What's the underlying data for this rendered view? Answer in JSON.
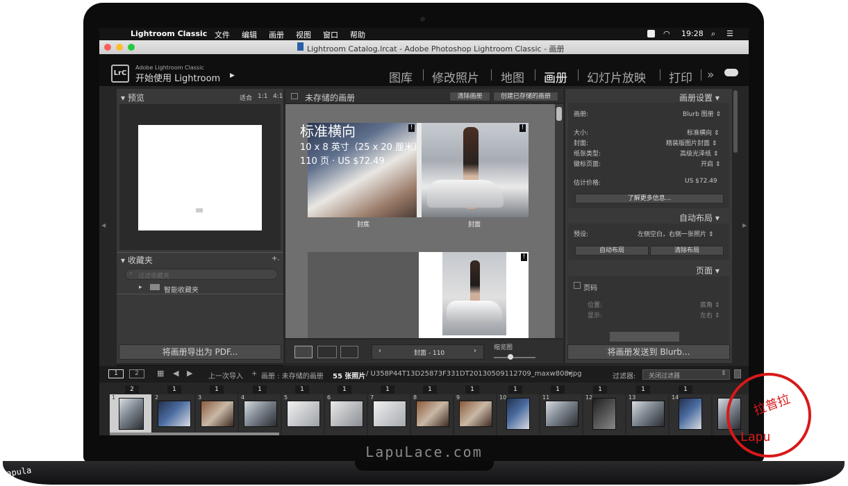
{
  "menubar": {
    "app": "Lightroom Classic",
    "items": [
      "文件",
      "编辑",
      "画册",
      "视图",
      "窗口",
      "帮助"
    ],
    "time": "19:28"
  },
  "window": {
    "title": "Lightroom Catalog.lrcat - Adobe Photoshop Lightroom Classic - 画册"
  },
  "identity": {
    "brand": "Adobe Lightroom Classic",
    "title": "开始使用 Lightroom",
    "logo": "LrC"
  },
  "modules": {
    "library": "图库",
    "develop": "修改照片",
    "map": "地图",
    "book": "画册",
    "slideshow": "幻灯片放映",
    "print": "打印",
    "more": "»"
  },
  "left": {
    "preview": {
      "title": "预览",
      "fit": "适合",
      "z1": "1:1",
      "z4": "4:1"
    },
    "collections": {
      "title": "收藏夹",
      "add": "+.",
      "filter_placeholder": "过滤收藏夹",
      "smart": "智能收藏夹"
    },
    "export_pdf": "将画册导出为 PDF..."
  },
  "center": {
    "header": "未存储的画册",
    "clear": "清除画册",
    "create": "创建已存储的画册",
    "overlay_line1": "标准横向",
    "overlay_line2": "10 x 8 英寸（25 x 20 厘米）",
    "overlay_line3": "110 页 · US $72.49",
    "back_cover": "封底",
    "front_cover": "封面",
    "page_indicator": "封面 - 110",
    "thumb_label": "缩览图"
  },
  "right": {
    "book_settings": {
      "title": "画册设置",
      "book_label": "画册:",
      "book_value": "Blurb 图册",
      "size_label": "大小:",
      "size_value": "标准横向",
      "cover_label": "封面:",
      "cover_value": "精装版图片封面",
      "paper_label": "纸张类型:",
      "paper_value": "高级光泽纸",
      "logo_label": "徽标页面:",
      "logo_value": "开启",
      "price_label": "估计价格:",
      "price_value": "US $72.49",
      "learn_more": "了解更多信息..."
    },
    "auto_layout": {
      "title": "自动布局",
      "preset_label": "预设:",
      "preset_value": "左侧空白，右侧一张照片",
      "auto_btn": "自动布局",
      "clear_btn": "清除布局"
    },
    "page": {
      "title": "页面",
      "page_numbers": "页码",
      "position_label": "位置:",
      "position_value": "底角",
      "display_label": "显示:",
      "display_value": "左右"
    },
    "send_btn": "将画册发送到 Blurb..."
  },
  "filmstrip_bar": {
    "view1": "1",
    "view2": "2",
    "last_import": "上一次导入",
    "source": "画册 : 未存储的画册",
    "count": "55 张照片",
    "path": "/ U358P44T13D25873F331DT20130509112709_maxw808.jpg",
    "filter_label": "过滤器:",
    "filter_value": "关闭过滤器"
  },
  "filmstrip": {
    "badges": [
      "2",
      "1",
      "1",
      "1",
      "1",
      "1",
      "1",
      "1",
      "1",
      "1",
      "1",
      "1",
      "1",
      "1"
    ],
    "numbers": [
      "1",
      "2",
      "3",
      "4",
      "5",
      "6",
      "7",
      "8",
      "9",
      "10",
      "11",
      "12",
      "13",
      "14"
    ]
  },
  "bezel_brand": "LapuLace.com",
  "watermark": {
    "left": "lapula",
    "stamp_top": "拉普拉",
    "stamp_bottom": "Lapu"
  },
  "colors": {
    "accent_red": "#d81818",
    "panel": "#393939",
    "header_bg": "#0f0f0f"
  }
}
